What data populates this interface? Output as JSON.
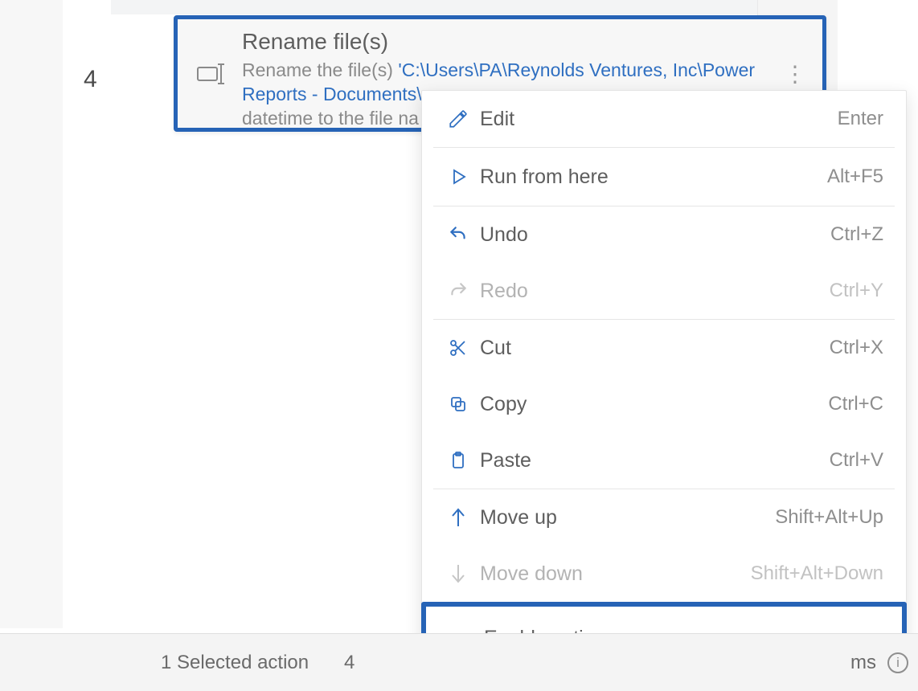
{
  "step_number": "4",
  "card": {
    "title": "Rename file(s)",
    "desc_prefix": "Rename the file(s) ",
    "desc_path": "'C:\\Users\\PA\\Reynolds Ventures, Inc\\Power Reports - Documents\\",
    "desc_suffix": "datetime to the file na"
  },
  "menu": {
    "edit": {
      "label": "Edit",
      "shortcut": "Enter"
    },
    "run": {
      "label": "Run from here",
      "shortcut": "Alt+F5"
    },
    "undo": {
      "label": "Undo",
      "shortcut": "Ctrl+Z"
    },
    "redo": {
      "label": "Redo",
      "shortcut": "Ctrl+Y"
    },
    "cut": {
      "label": "Cut",
      "shortcut": "Ctrl+X"
    },
    "copy": {
      "label": "Copy",
      "shortcut": "Ctrl+C"
    },
    "paste": {
      "label": "Paste",
      "shortcut": "Ctrl+V"
    },
    "moveup": {
      "label": "Move up",
      "shortcut": "Shift+Alt+Up"
    },
    "movedown": {
      "label": "Move down",
      "shortcut": "Shift+Alt+Down"
    },
    "enable": {
      "label": "Enable action",
      "shortcut": ""
    }
  },
  "statusbar": {
    "selected": "1 Selected action",
    "cutoff_num": "4",
    "ms": "ms"
  }
}
